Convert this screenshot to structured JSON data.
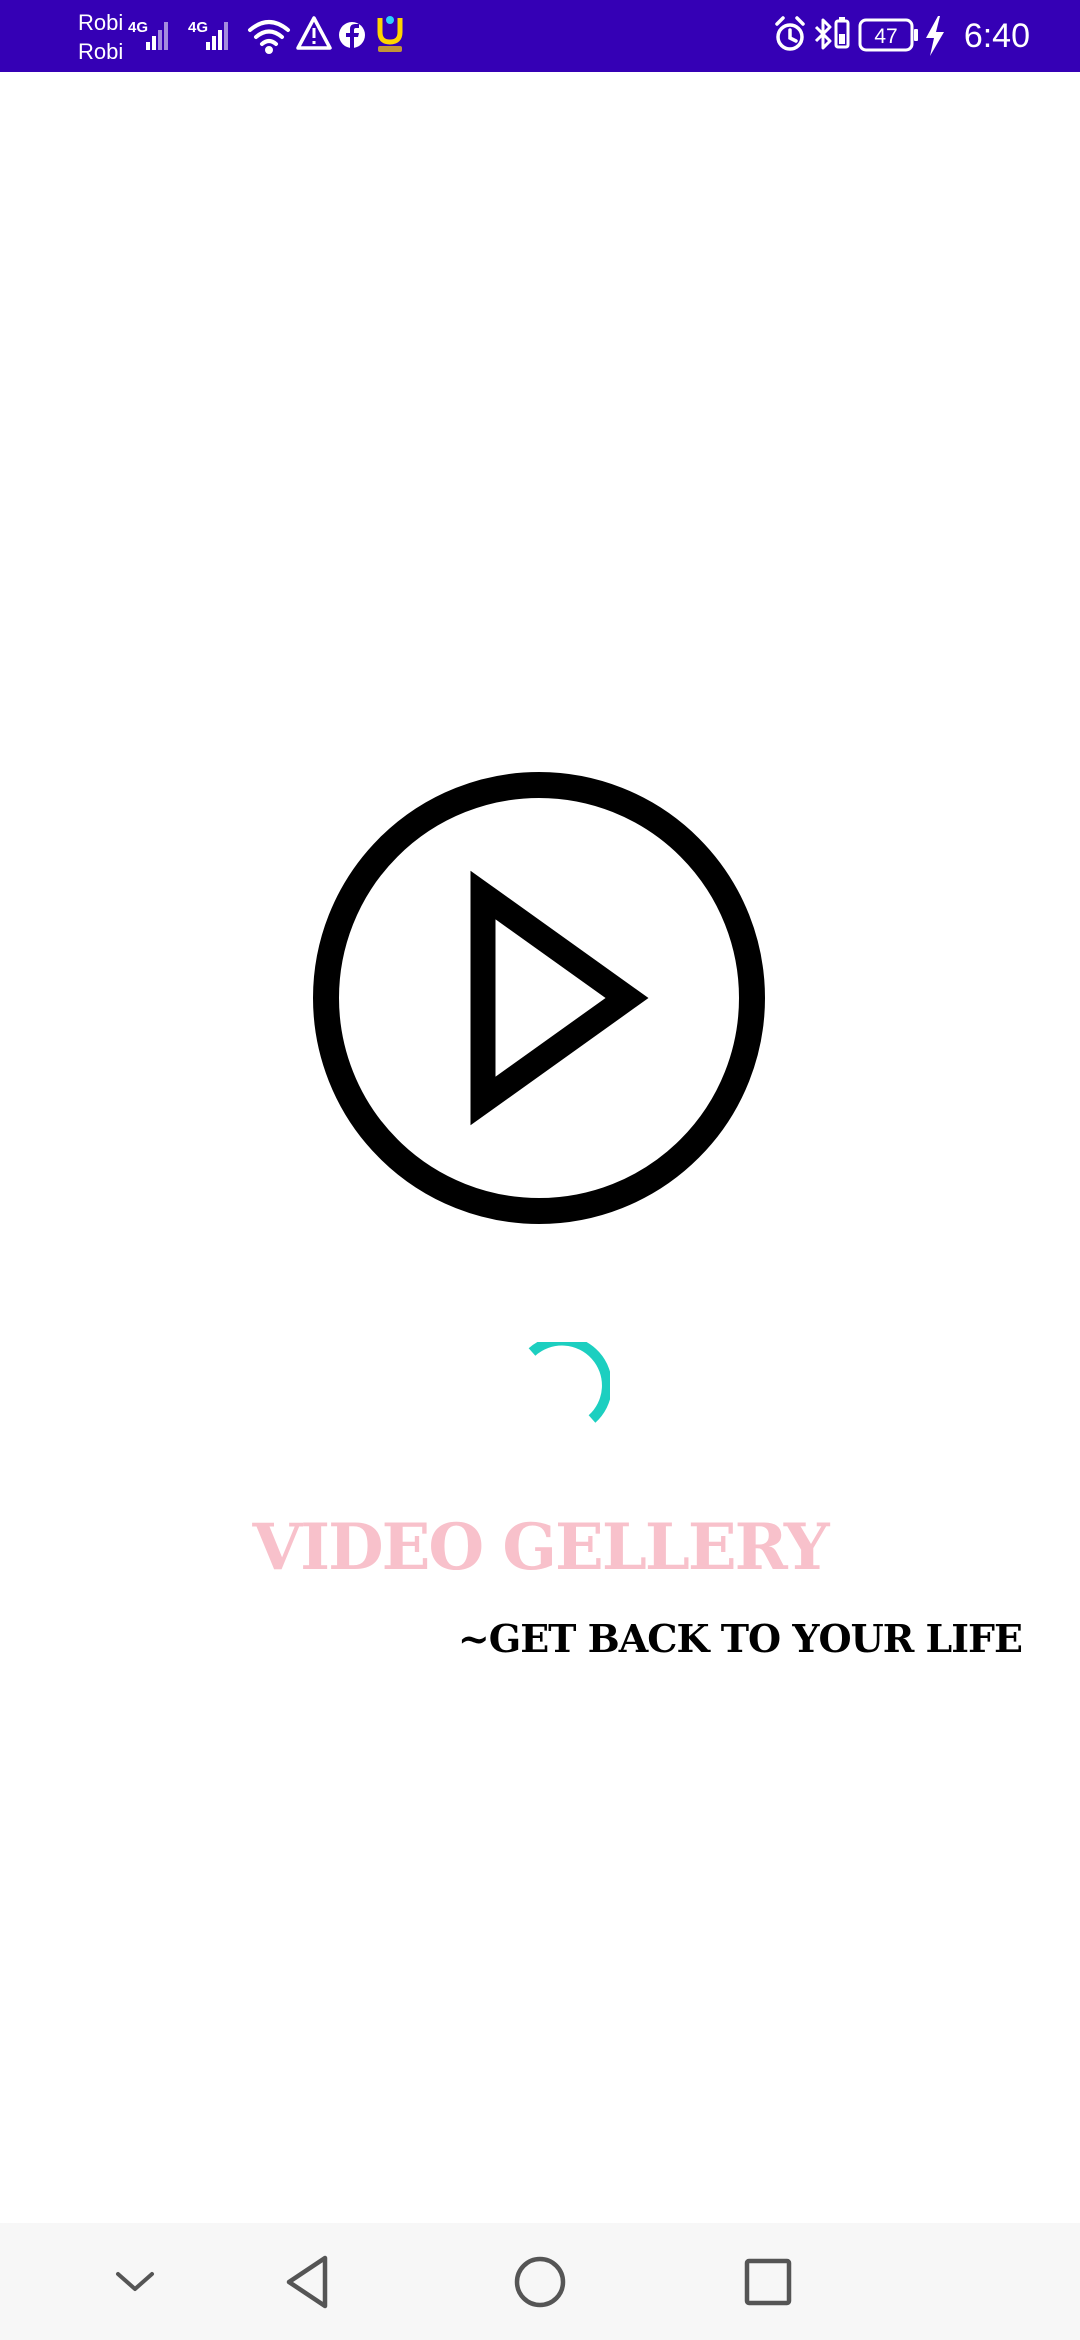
{
  "status_bar": {
    "carrier_1": "Robi",
    "carrier_2": "Robi",
    "network_1": "4G",
    "network_2": "4G",
    "battery_level": "47",
    "time": "6:40",
    "background_color": "#3500b5",
    "icons": [
      "signal-icon",
      "signal-icon",
      "wifi-icon",
      "warning-icon",
      "facebook-icon",
      "app-notification-icon",
      "alarm-icon",
      "bluetooth-icon",
      "battery-saver-icon",
      "battery-icon",
      "charging-icon"
    ]
  },
  "splash": {
    "logo_icon": "play-circle-icon",
    "spinner_color": "#1ccfc0",
    "title": "VIDEO GELLERY",
    "title_color": "#f8c1cb",
    "tagline": "~GET BACK TO YOUR LIFE"
  },
  "nav_bar": {
    "buttons": [
      "chevron-down-icon",
      "back-icon",
      "home-icon",
      "recents-icon"
    ]
  }
}
